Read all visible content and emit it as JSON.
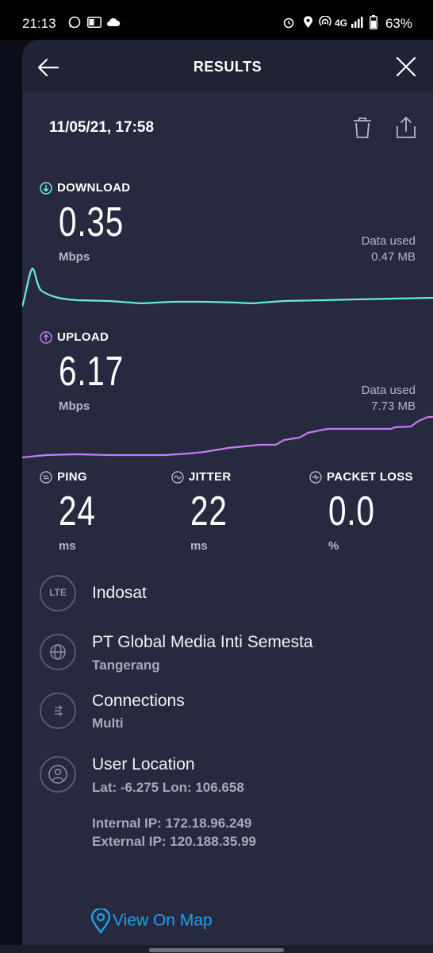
{
  "status_bar": {
    "time": "21:13",
    "network": "4G",
    "battery": "63%"
  },
  "header": {
    "title": "RESULTS",
    "back_icon": "arrow-left-icon",
    "close_icon": "close-icon"
  },
  "test": {
    "datetime": "11/05/21, 17:58",
    "delete_icon": "trash-icon",
    "share_icon": "share-icon"
  },
  "download": {
    "label": "DOWNLOAD",
    "value": "0.35",
    "unit": "Mbps",
    "data_used_label": "Data used",
    "data_used_value": "0.47 MB",
    "color": "#6ce8e2"
  },
  "upload": {
    "label": "UPLOAD",
    "value": "6.17",
    "unit": "Mbps",
    "data_used_label": "Data used",
    "data_used_value": "7.73 MB",
    "color": "#c57cf5"
  },
  "ping": {
    "label": "PING",
    "value": "24",
    "unit": "ms"
  },
  "jitter": {
    "label": "JITTER",
    "value": "22",
    "unit": "ms"
  },
  "packet_loss": {
    "label": "PACKET LOSS",
    "value": "0.0",
    "unit": "%"
  },
  "provider": {
    "badge": "LTE",
    "name": "Indosat"
  },
  "server": {
    "name": "PT Global Media Inti Semesta",
    "city": "Tangerang"
  },
  "connections": {
    "title": "Connections",
    "value": "Multi"
  },
  "user_location": {
    "title": "User Location",
    "coords": "Lat: -6.275 Lon: 106.658",
    "internal_ip": "Internal IP: 172.18.96.249",
    "external_ip": "External IP: 120.188.35.99"
  },
  "map_link": {
    "label": "View On Map",
    "color": "#1da1f2"
  }
}
